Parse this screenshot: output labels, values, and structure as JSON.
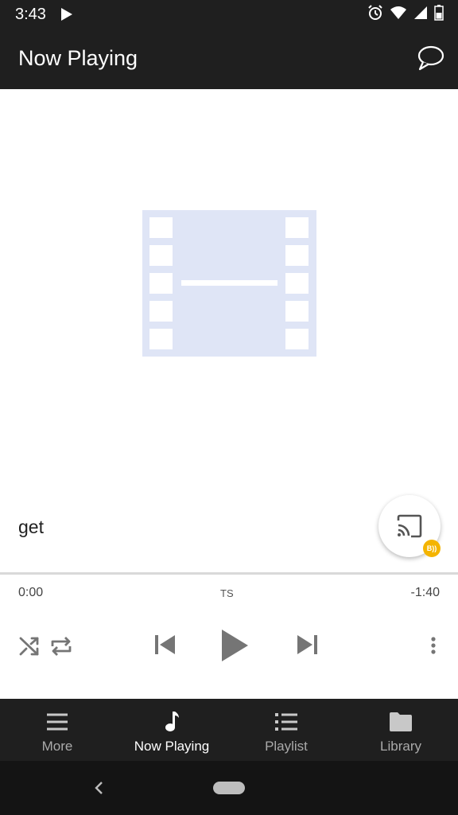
{
  "status_bar": {
    "time": "3:43",
    "icons": [
      "play-icon",
      "alarm-icon",
      "wifi-icon",
      "signal-icon",
      "battery-icon"
    ]
  },
  "app_bar": {
    "title": "Now Playing",
    "action_icon": "chat-bubble-icon"
  },
  "player": {
    "artwork_icon": "film-icon",
    "track_title": "get",
    "elapsed": "0:00",
    "format": "TS",
    "remaining": "-1:40",
    "progress": 0,
    "cast_badge": "B))"
  },
  "controls": [
    "shuffle-icon",
    "repeat-icon",
    "skip-previous-icon",
    "play-icon",
    "skip-next-icon",
    "more-vert-icon"
  ],
  "bottom_nav": {
    "items": [
      {
        "label": "More",
        "icon": "menu-icon",
        "active": false
      },
      {
        "label": "Now Playing",
        "icon": "music-note-icon",
        "active": true
      },
      {
        "label": "Playlist",
        "icon": "list-icon",
        "active": false
      },
      {
        "label": "Library",
        "icon": "folder-icon",
        "active": false
      }
    ]
  },
  "colors": {
    "bar_background": "#1f1f1f",
    "artwork_fill": "#dfe5f6",
    "cast_badge": "#f4b400",
    "control_gray": "#757575"
  }
}
